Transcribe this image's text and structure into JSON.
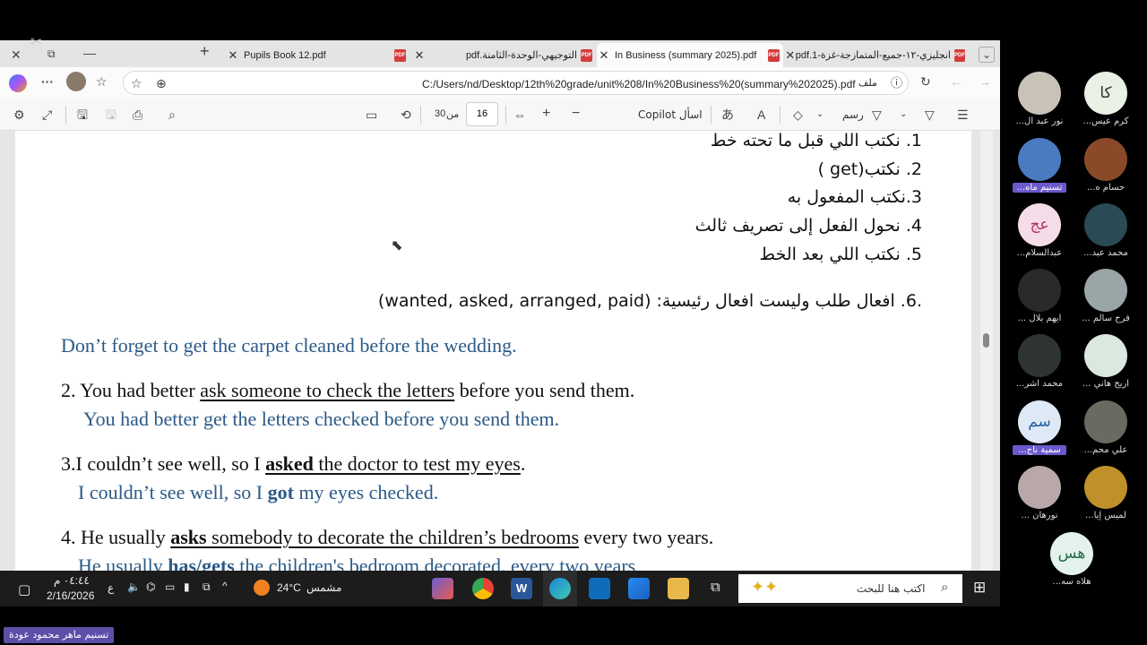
{
  "tabs": [
    {
      "label": "Pupils Book 12.pdf"
    },
    {
      "label": "التوجيهي-الوحدة-الثامنة.pdf"
    },
    {
      "label": "In Business (summary 2025).pdf"
    },
    {
      "label": "انجليزي-١٢-جميع-المتمازجة-غزة-1.pdf"
    }
  ],
  "address": {
    "file_label": "ملف",
    "url": "C:/Users/nd/Desktop/12th%20grade/unit%208/In%20Business%20(summary%202025).pdf"
  },
  "pdf_toolbar": {
    "current_page": "16",
    "of_label": "من",
    "total_pages": "30",
    "copilot_label": "اسأل Copilot",
    "draw_label": "رسم"
  },
  "document": {
    "rules": [
      "1. نكتب اللي قبل ما تحته خط",
      "2. نكتب(get )",
      "3.نكتب المفعول به",
      "4. نحول الفعل إلى تصريف ثالث",
      "5. نكتب اللي بعد الخط"
    ],
    "rule6": ".6. افعال طلب وليست افعال رئيسية: (wanted, asked, arranged, paid)",
    "ex1_answer": "Don’t forget to get the carpet cleaned before the wedding.",
    "ex2_pre": "2. You had better ",
    "ex2_underlined": "ask someone to check the letters",
    "ex2_post": " before you send them.",
    "ex2_answer": "You had better get the letters checked before you send them.",
    "ex3_pre": "3.I couldn’t see well, so I ",
    "ex3_bold": "asked",
    "ex3_underlined": " the doctor to test my eyes",
    "ex3_post": ".",
    "ex3_answer_pre": "I couldn’t see well, so I ",
    "ex3_answer_bold": "got",
    "ex3_answer_post": " my eyes checked.",
    "ex4_pre": "4. He usually ",
    "ex4_bold": "asks",
    "ex4_underlined": " somebody to decorate the children’s bedrooms",
    "ex4_post": " every two years.",
    "ex4_answer_pre": "He usually ",
    "ex4_answer_bold": "has/gets",
    "ex4_answer_post": " the children's bedroom decorated, every two years"
  },
  "taskbar": {
    "time": "٠٤:٤٤ م",
    "date": "2/16/2026",
    "lang": "ع",
    "weather_temp": "24°C",
    "weather_label": "مشمس",
    "search_placeholder": "اكتب هنا للبحث"
  },
  "participants": [
    {
      "initials": "كا",
      "name": "كرم عيس...",
      "bg": "#e9f1e4"
    },
    {
      "initials": "",
      "name": "نور عبد ال...",
      "bg": "#c9c2b8"
    },
    {
      "initials": "",
      "name": "حسام ه...",
      "bg": "#8a4a2a"
    },
    {
      "initials": "",
      "name": "تسنيم ماه...",
      "bg": "#4a7ac0",
      "highlight": true
    },
    {
      "initials": "",
      "name": "محمد عبد...",
      "bg": "#2a4a55"
    },
    {
      "initials": "عج",
      "name": "عبدالسلام...",
      "bg": "#f4dde8"
    },
    {
      "initials": "",
      "name": "فرح سالم ...",
      "bg": "#9aa5a8"
    },
    {
      "initials": "",
      "name": "أيهم بلال ...",
      "bg": "#2a2a2a"
    },
    {
      "initials": "",
      "name": "اريج هاني ...",
      "bg": "#dbe8e0"
    },
    {
      "initials": "",
      "name": "محمد اشر...",
      "bg": "#2e3530"
    },
    {
      "initials": "",
      "name": "علي محم...",
      "bg": "#6a6a60"
    },
    {
      "initials": "سم",
      "name": "سمية ناج...",
      "bg": "#dfe9f6",
      "highlight": true
    },
    {
      "initials": "",
      "name": "لميس إيا...",
      "bg": "#c0902a"
    },
    {
      "initials": "",
      "name": "نورهان ...",
      "bg": "#b8a8a8"
    },
    {
      "initials": "هس",
      "name": "هلاه سه...",
      "bg": "#e3f2ec"
    }
  ],
  "footer_badge": "تسنيم ماهر محمود عودة"
}
